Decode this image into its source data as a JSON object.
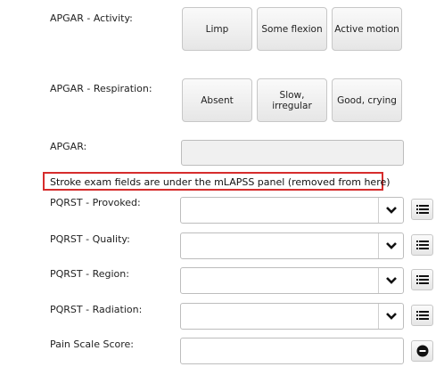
{
  "apgar_activity": {
    "label": "APGAR - Activity:",
    "options": [
      "Limp",
      "Some flexion",
      "Active motion"
    ]
  },
  "apgar_respiration": {
    "label": "APGAR - Respiration:",
    "options": [
      "Absent",
      "Slow, irregular",
      "Good, crying"
    ]
  },
  "apgar_total": {
    "label": "APGAR:",
    "value": ""
  },
  "notice": "Stroke exam fields are under the mLAPSS panel (removed from here)",
  "pqrst": [
    {
      "label": "PQRST - Provoked:",
      "value": ""
    },
    {
      "label": "PQRST - Quality:",
      "value": ""
    },
    {
      "label": "PQRST - Region:",
      "value": ""
    },
    {
      "label": "PQRST - Radiation:",
      "value": ""
    }
  ],
  "pain_scale": {
    "label": "Pain Scale Score:",
    "value": ""
  },
  "icons": {
    "dropdown": "chevron-down-icon",
    "list": "list-icon",
    "clear": "minus-circle-icon"
  }
}
